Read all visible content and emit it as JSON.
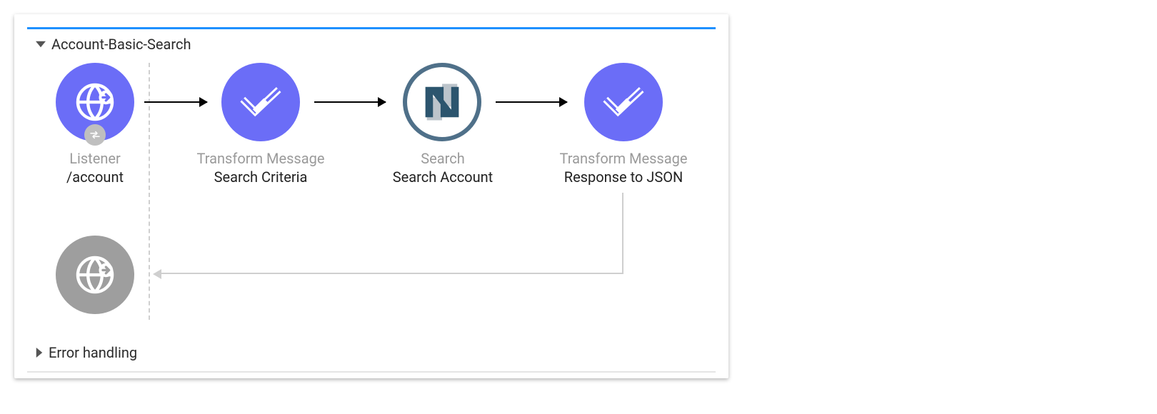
{
  "flow": {
    "title": "Account-Basic-Search",
    "error_section": "Error handling",
    "nodes": {
      "listener": {
        "type": "Listener",
        "name": "/account"
      },
      "transform1": {
        "type": "Transform Message",
        "name": "Search Criteria"
      },
      "search": {
        "type": "Search",
        "name": "Search Account"
      },
      "transform2": {
        "type": "Transform Message",
        "name": "Response to JSON"
      }
    }
  },
  "colors": {
    "purple": "#6B6DF7",
    "netsuite_ring": "#4F7089",
    "grey": "#9E9E9E",
    "accent": "#1E90FF"
  }
}
